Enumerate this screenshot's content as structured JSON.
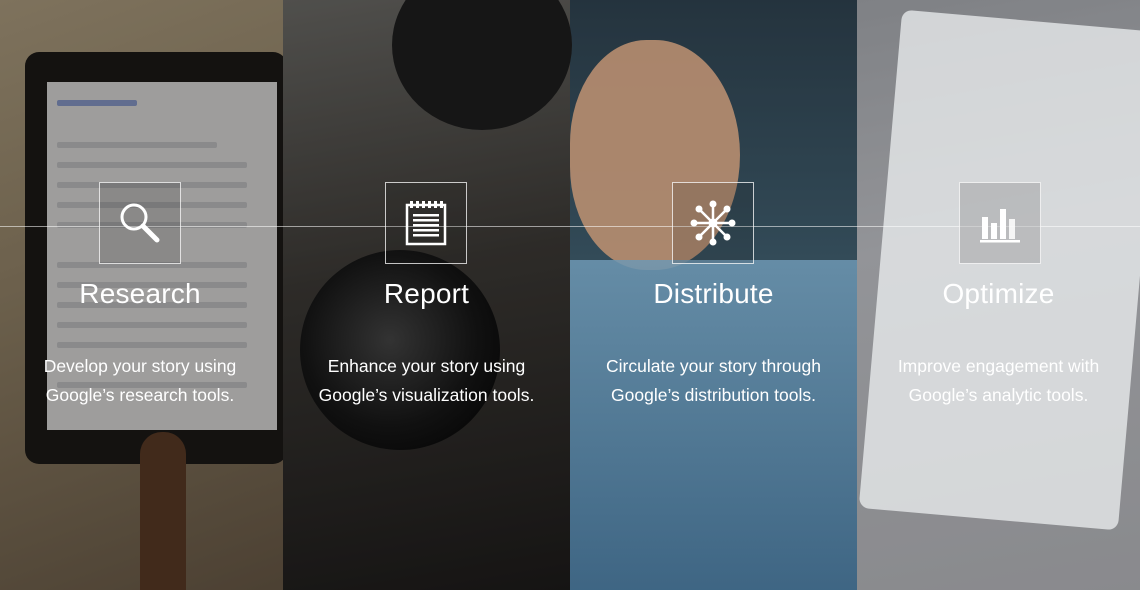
{
  "features": [
    {
      "id": "research",
      "icon": "magnifier-icon",
      "title": "Research",
      "desc_line1": "Develop your story using",
      "desc_line2": "Google’s research tools."
    },
    {
      "id": "report",
      "icon": "notepad-icon",
      "title": "Report",
      "desc_line1": "Enhance your story using",
      "desc_line2": "Google’s visualization tools."
    },
    {
      "id": "distribute",
      "icon": "network-icon",
      "title": "Distribute",
      "desc_line1": "Circulate your story through",
      "desc_line2": "Google’s distribution tools."
    },
    {
      "id": "optimize",
      "icon": "bar-chart-icon",
      "title": "Optimize",
      "desc_line1": "Improve engagement with",
      "desc_line2": "Google’s analytic tools."
    }
  ]
}
